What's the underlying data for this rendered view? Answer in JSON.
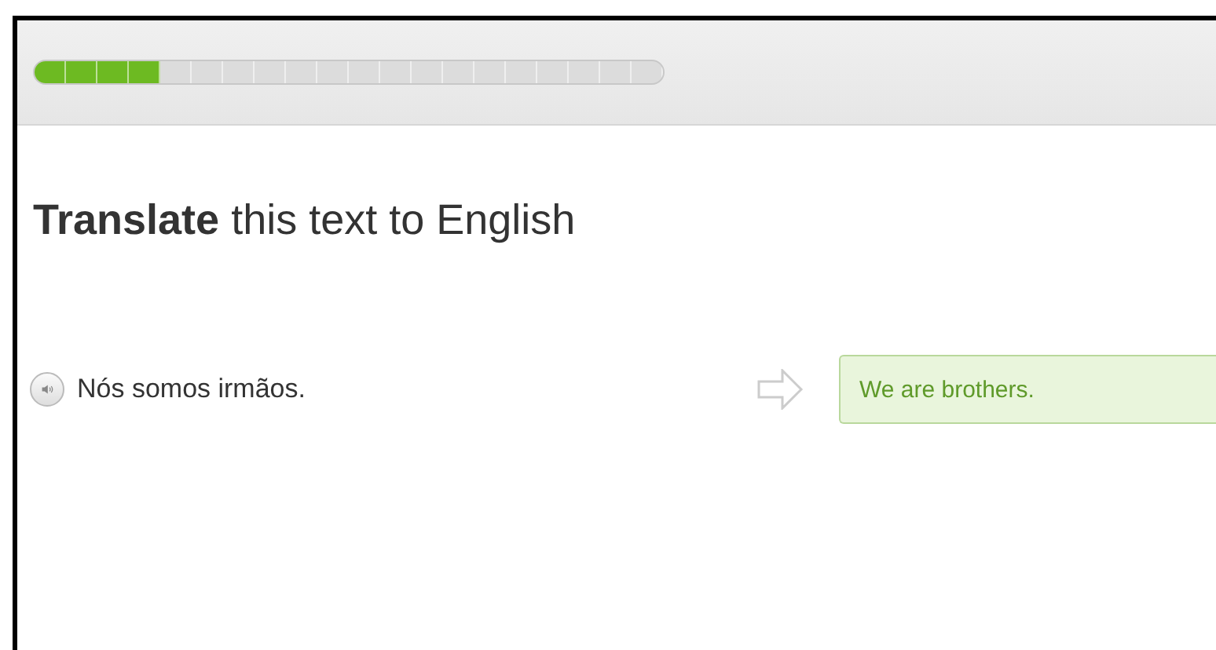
{
  "progress": {
    "level": 0.2
  },
  "instruction": "**Translate** this text to English",
  "sentence": "Nós somos irmãos.",
  "answer": {
    "value": "We are brothers.",
    "correct": true
  }
}
